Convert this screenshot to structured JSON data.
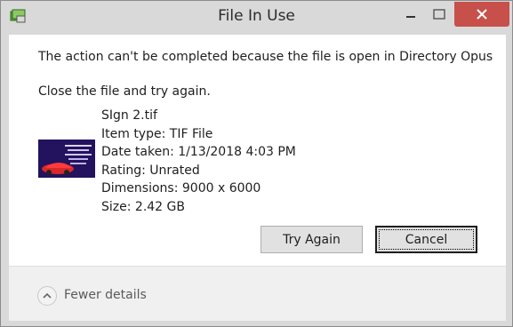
{
  "window": {
    "title": "File In Use"
  },
  "dialog": {
    "message": "The action can't be completed because the file is open in Directory Opus",
    "instruction": "Close the file and try again."
  },
  "file": {
    "name": "SIgn 2.tif",
    "item_type": "Item type: TIF File",
    "date_taken": "Date taken: 1/13/2018 4:03 PM",
    "rating": "Rating: Unrated",
    "dimensions": "Dimensions: 9000 x 6000",
    "size": "Size: 2.42 GB",
    "thumbnail_icon": "image-thumbnail"
  },
  "buttons": {
    "try_again": "Try Again",
    "cancel": "Cancel"
  },
  "footer": {
    "details_toggle": "Fewer details",
    "toggle_icon": "chevron-up-icon"
  },
  "colors": {
    "close_button": "#c7504b",
    "title_bar": "#d9d9d9",
    "thumbnail_bg": "#2a1670"
  }
}
